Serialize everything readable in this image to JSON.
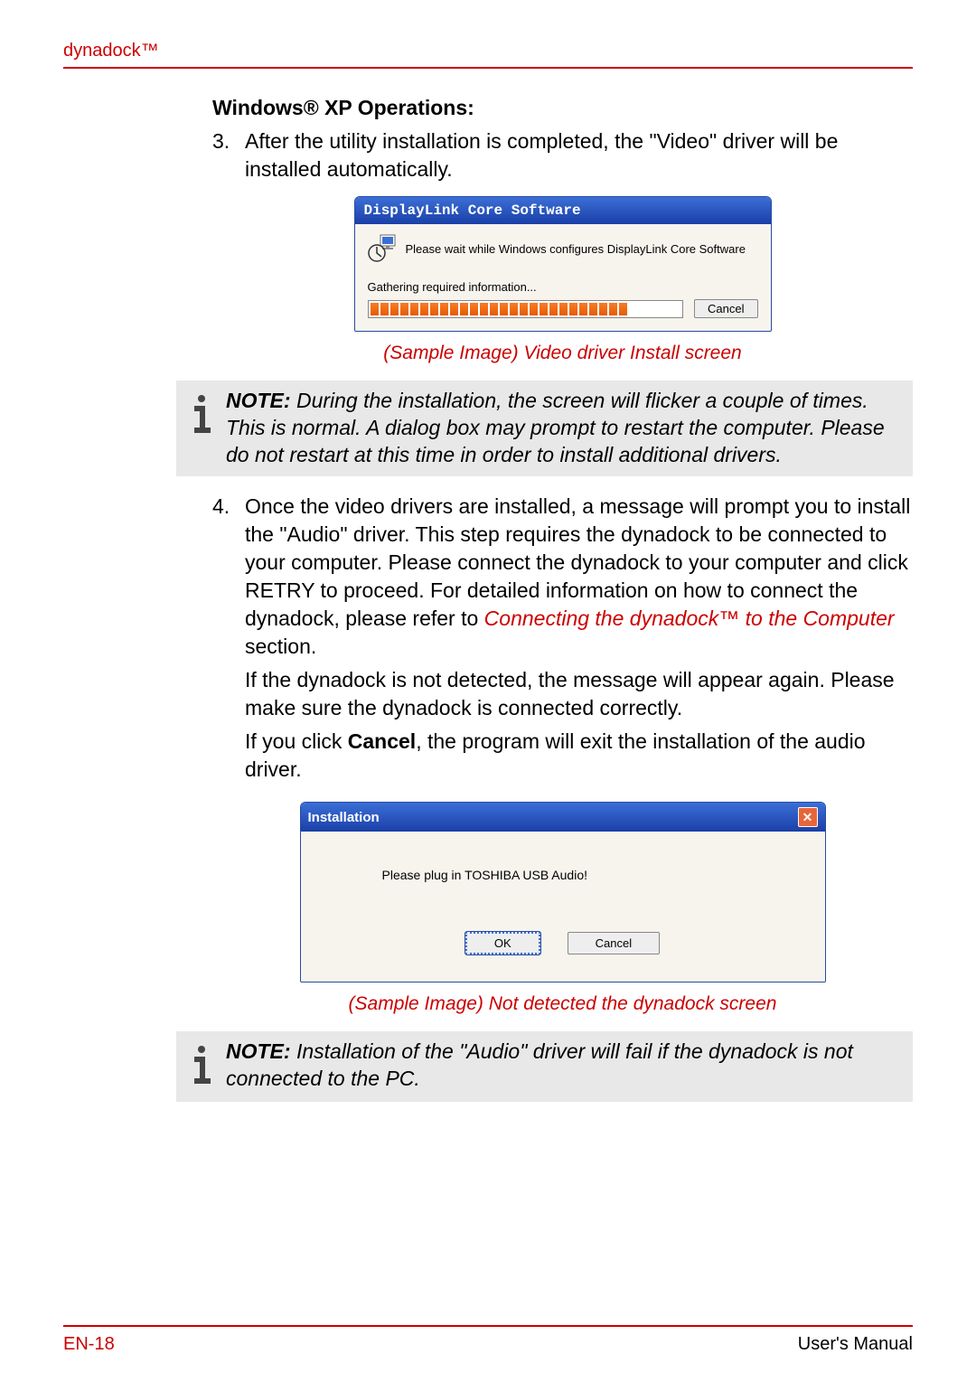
{
  "header": {
    "brand": "dynadock™"
  },
  "section": {
    "title": "Windows® XP Operations:"
  },
  "step3": {
    "num": "3.",
    "text": "After the utility installation is completed, the \"Video\" driver will be installed automatically."
  },
  "dialog1": {
    "title": "DisplayLink Core Software",
    "message": "Please wait while Windows configures DisplayLink Core Software",
    "status": "Gathering required information...",
    "cancel": "Cancel"
  },
  "caption1": "(Sample Image) Video driver Install screen",
  "note1": {
    "label": "NOTE:",
    "text": "During the installation, the screen will flicker a couple of times. This is normal. A dialog box may prompt to restart the computer. Please do not restart at this time in order to install additional drivers."
  },
  "step4": {
    "num": "4.",
    "p1a": "Once the video drivers are installed, a message will prompt you to install the \"Audio\" driver. This step requires the dynadock to be connected to your computer. Please connect the dynadock to your computer and click RETRY to proceed. For detailed information on how to connect the dynadock, please refer to ",
    "link": "Connecting the dynadock™ to the Computer",
    "p1b": " section.",
    "p2": "If the dynadock is not detected, the message will appear again. Please make sure the dynadock is connected correctly.",
    "p3a": "If you click ",
    "p3bold": "Cancel",
    "p3b": ", the program will exit the installation of the audio driver."
  },
  "dialog2": {
    "title": "Installation",
    "message": "Please plug in TOSHIBA USB Audio!",
    "ok": "OK",
    "cancel": "Cancel"
  },
  "caption2": "(Sample Image) Not detected the dynadock screen",
  "note2": {
    "label": "NOTE:",
    "text": "Installation of the \"Audio\" driver will fail if the dynadock is not connected to the PC."
  },
  "footer": {
    "page": "EN-18",
    "manual": "User's Manual"
  }
}
